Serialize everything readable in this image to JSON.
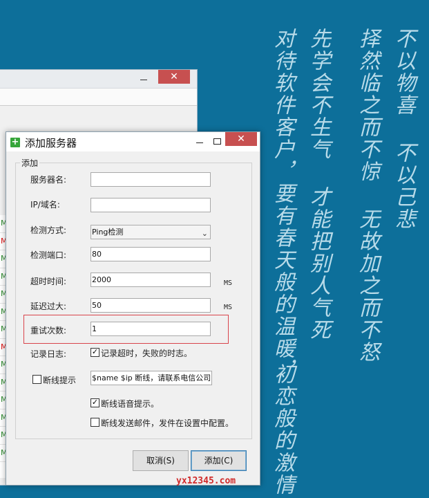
{
  "desktop_poem": {
    "col1": "不以物喜 不以己悲",
    "col2": "择然临之而不惊 无故加之而不怒",
    "col3": "先学会不生气 才能把别人气死",
    "col4": "对待软件客户，要有春天般的温暖，",
    "col5": "初恋般的激情"
  },
  "background_window": {
    "close_label": "✕",
    "rows": [
      "M",
      "M",
      "M",
      "M",
      "M",
      "M",
      "M",
      "M",
      "M",
      "M",
      "M",
      "M",
      "M",
      "M"
    ]
  },
  "dialog": {
    "title": "添加服务器",
    "icon": "plus-icon",
    "close_label": "✕",
    "group_label": "添加",
    "fields": {
      "server_name": {
        "label": "服务器名:",
        "value": ""
      },
      "ip_domain": {
        "label": "IP/域名:",
        "value": ""
      },
      "check_method": {
        "label": "检测方式:",
        "value": "Ping检测"
      },
      "check_port": {
        "label": "检测端口:",
        "value": "80"
      },
      "timeout": {
        "label": "超时时间:",
        "value": "2000",
        "unit": "MS"
      },
      "latency": {
        "label": "延迟过大:",
        "value": "50",
        "unit": "MS"
      },
      "retries": {
        "label": "重试次数:",
        "value": "1"
      }
    },
    "log": {
      "label": "记录日志:",
      "checkbox_label": "记录超时，失败的时志。",
      "checked": true
    },
    "disconnect_prompt": {
      "checkbox_label": "断线提示",
      "checked": false,
      "value": "$name $ip 断线，请联系电信公司"
    },
    "voice_prompt": {
      "checkbox_label": "断线语音提示。",
      "checked": true
    },
    "email_prompt": {
      "checkbox_label": "断线发送邮件，发件在设置中配置。",
      "checked": false
    },
    "cancel_label": "取消(S)",
    "add_label": "添加(C)"
  },
  "watermark": "yx12345.com",
  "colors": {
    "desktop": "#0d6f9a",
    "highlight": "#d9434b",
    "watermark": "#d02a2a"
  }
}
